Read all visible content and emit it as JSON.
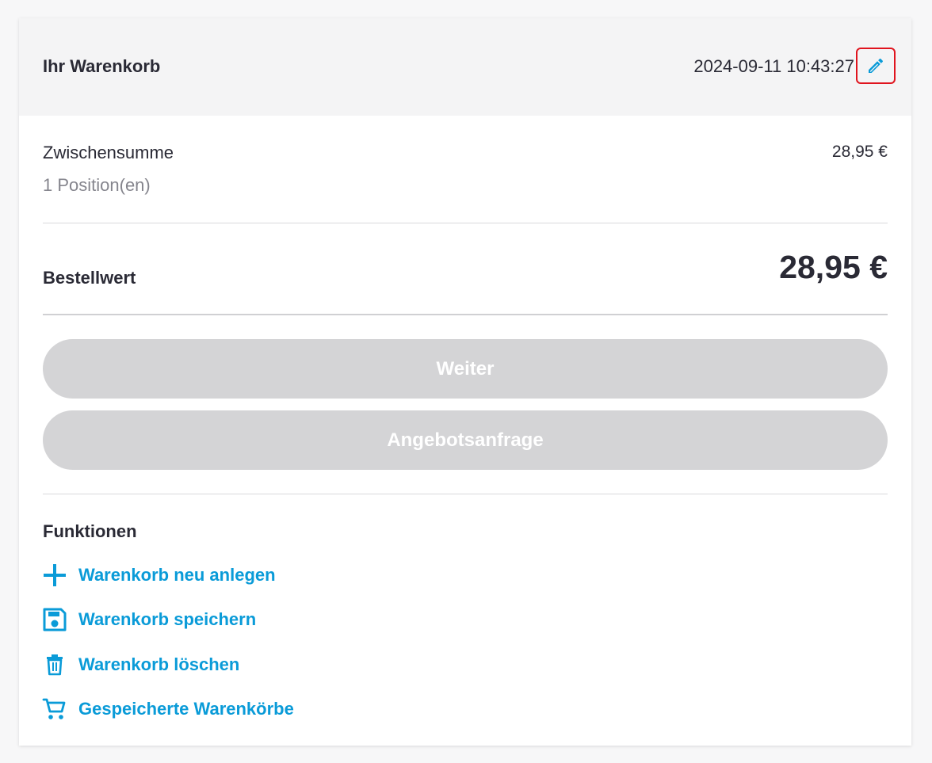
{
  "header": {
    "title": "Ihr Warenkorb",
    "timestamp": "2024-09-11 10:43:27",
    "edit_icon": "pencil-icon"
  },
  "summary": {
    "subtotal_label": "Zwischensumme",
    "subtotal_value": "28,95 €",
    "positions_label": "1 Position(en)",
    "total_label": "Bestellwert",
    "total_value": "28,95 €"
  },
  "actions": {
    "continue_label": "Weiter",
    "quote_label": "Angebotsanfrage"
  },
  "functions": {
    "title": "Funktionen",
    "items": [
      {
        "label": "Warenkorb neu anlegen",
        "icon": "plus-icon"
      },
      {
        "label": "Warenkorb speichern",
        "icon": "save-icon"
      },
      {
        "label": "Warenkorb löschen",
        "icon": "trash-icon"
      },
      {
        "label": "Gespeicherte Warenkörbe",
        "icon": "cart-icon"
      }
    ]
  },
  "colors": {
    "accent": "#0a9bd8",
    "highlight": "#e0141e",
    "button_disabled": "#d4d4d6"
  }
}
